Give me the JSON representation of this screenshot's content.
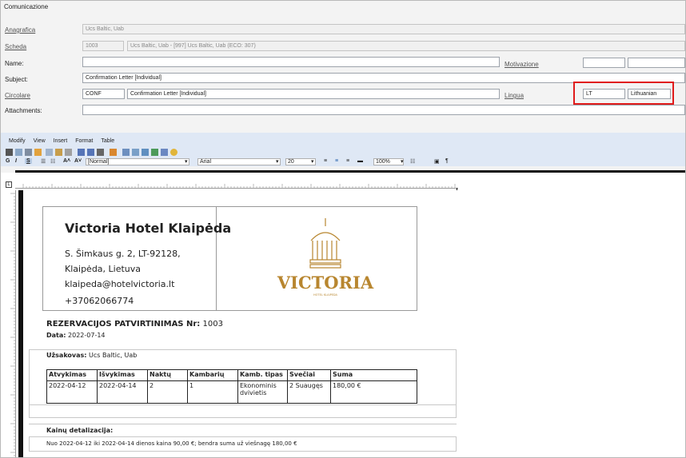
{
  "window": {
    "title": "Comunicazione"
  },
  "form": {
    "anagrafica": {
      "label": "Anagrafica",
      "value": "Ucs Baltic, Uab"
    },
    "scheda": {
      "label": "Scheda",
      "code": "1003",
      "value": "Ucs Baltic, Uab  - [997] Ucs Baltic, Uab (ECO: 307)"
    },
    "name": {
      "label": "Name:",
      "value": ""
    },
    "motivazione": {
      "label": "Motivazione",
      "code": "",
      "value": ""
    },
    "subject": {
      "label": "Subject:",
      "value": "Confirmation Letter [Individual]"
    },
    "circolare": {
      "label": "Circolare",
      "code": "CONF",
      "value": "Confirmation Letter [Individual]"
    },
    "lingua": {
      "label": "Lingua",
      "code": "LT",
      "value": "Lithuanian"
    },
    "attachments": {
      "label": "Attachments:",
      "value": ""
    }
  },
  "editor": {
    "menu": [
      "Modify",
      "View",
      "Insert",
      "Format",
      "Table"
    ],
    "style": "[Normal]",
    "font": "Arial",
    "size": "20",
    "zoom": "100%",
    "accent": "#1e5aa8"
  },
  "document": {
    "hotel_name": "Victoria Hotel Klaipėda",
    "address1": "S. Šimkaus g. 2, LT-92128,",
    "address2": "Klaipėda, Lietuva",
    "email": "klaipeda@hotelvictoria.lt",
    "phone": "+37062066774",
    "logo_text": "VICTORIA",
    "logo_sub": "HOTEL KLAIPEDA",
    "logo_color": "#b8862f",
    "heading": "REZERVACIJOS PATVIRTINIMAS Nr:",
    "heading_no": "1003",
    "date_label": "Data:",
    "date_value": "2022-07-14",
    "orderer_label": "Užsakovas:",
    "orderer_value": "Ucs Baltic, Uab",
    "table": {
      "headers": [
        "Atvykimas",
        "Išvykimas",
        "Naktų",
        "Kambarių",
        "Kamb. tipas",
        "Svečiai",
        "Suma"
      ],
      "row": [
        "2022-04-12",
        "2022-04-14",
        "2",
        "1",
        "Ekonominis dvivietis",
        "2 Suaugęs",
        "180,00  €"
      ]
    },
    "details_label": "Kainų detalizacija:",
    "details_text": "Nuo 2022-04-12 iki 2022-04-14 dienos kaina 90,00 €; bendra suma už viešnagę 180,00 €"
  }
}
